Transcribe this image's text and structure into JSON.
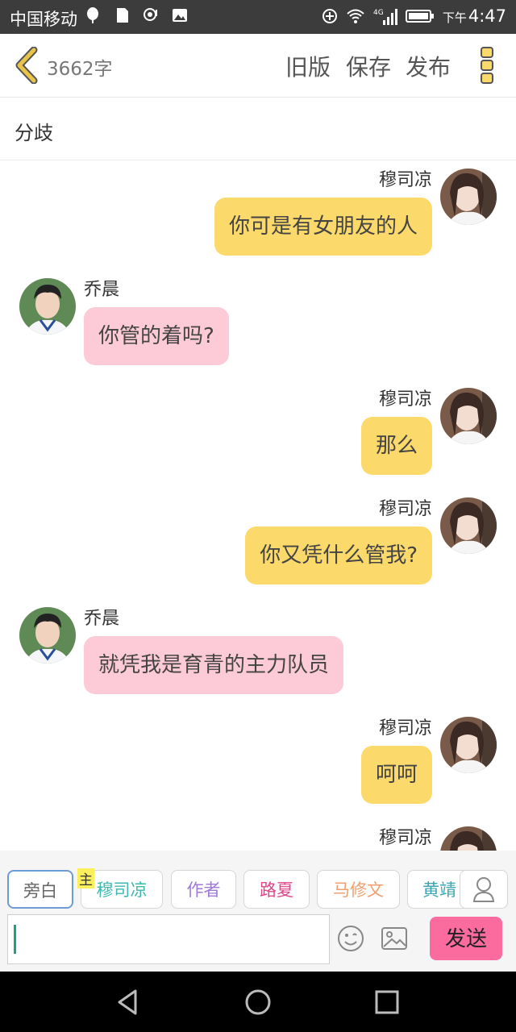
{
  "status_bar": {
    "carrier": "中国移动",
    "time_prefix": "下午",
    "time": "4:47",
    "network": "4G"
  },
  "header": {
    "word_count": "3662字",
    "old_version": "旧版",
    "save": "保存",
    "publish": "发布"
  },
  "title": "分歧",
  "messages": [
    {
      "side": "right",
      "sender": "穆司凉",
      "text": "你可是有女朋友的人"
    },
    {
      "side": "left",
      "sender": "乔晨",
      "text": "你管的着吗?"
    },
    {
      "side": "right",
      "sender": "穆司凉",
      "text": "那么"
    },
    {
      "side": "right",
      "sender": "穆司凉",
      "text": "你又凭什么管我?"
    },
    {
      "side": "left",
      "sender": "乔晨",
      "text": "就凭我是育青的主力队员"
    },
    {
      "side": "right",
      "sender": "穆司凉",
      "text": "呵呵"
    },
    {
      "side": "right",
      "sender": "穆司凉",
      "text": ""
    }
  ],
  "roles": [
    {
      "label": "旁白",
      "color": "#666666"
    },
    {
      "label": "穆司凉",
      "color": "#3cb8b0"
    },
    {
      "label": "作者",
      "color": "#a07ad8"
    },
    {
      "label": "路夏",
      "color": "#e0458a"
    },
    {
      "label": "马修文",
      "color": "#f0a070"
    },
    {
      "label": "黄靖",
      "color": "#3aa6b0"
    }
  ],
  "main_badge": "主",
  "input": {
    "value": ""
  },
  "send_label": "发送",
  "colors": {
    "right_bubble": "#fcd96b",
    "left_bubble": "#fccbd7",
    "send": "#fb6b9d",
    "back_arrow": "#e8c44a"
  }
}
